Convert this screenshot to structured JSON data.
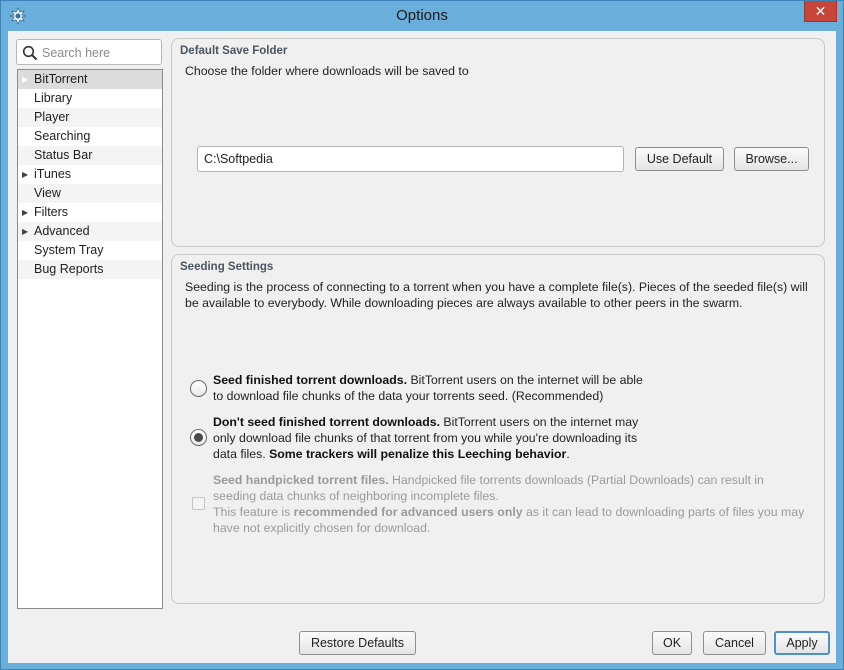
{
  "window": {
    "title": "Options"
  },
  "search": {
    "placeholder": "Search here"
  },
  "sidebar": {
    "items": [
      {
        "label": "BitTorrent",
        "expandable": true
      },
      {
        "label": "Library",
        "expandable": false
      },
      {
        "label": "Player",
        "expandable": false
      },
      {
        "label": "Searching",
        "expandable": false
      },
      {
        "label": "Status Bar",
        "expandable": false
      },
      {
        "label": "iTunes",
        "expandable": true
      },
      {
        "label": "View",
        "expandable": false
      },
      {
        "label": "Filters",
        "expandable": true
      },
      {
        "label": "Advanced",
        "expandable": true
      },
      {
        "label": "System Tray",
        "expandable": false
      },
      {
        "label": "Bug Reports",
        "expandable": false
      }
    ],
    "selected_index": 0
  },
  "save_folder": {
    "title": "Default Save Folder",
    "description": "Choose the folder where downloads will be saved to",
    "path_value": "C:\\Softpedia",
    "use_default_label": "Use Default",
    "browse_label": "Browse..."
  },
  "seeding": {
    "title": "Seeding Settings",
    "description_line1": "Seeding is the process of connecting to a torrent when you have a complete file(s). Pieces of the seeded file(s) will",
    "description_line2": "be available to everybody. While downloading pieces are always available to other peers in the swarm.",
    "options": {
      "seed": {
        "bold": "Seed finished torrent downloads.",
        "text_line1": " BitTorrent users on the internet will be able",
        "text_line2": "to download file chunks of the data your torrents seed. (Recommended)",
        "selected": false
      },
      "dont_seed": {
        "bold": "Don't seed finished torrent downloads.",
        "text_line1": " BitTorrent users on the internet may",
        "text_line2": "only download file chunks of that torrent from you while you're downloading its",
        "text_line3_plain": "data files. ",
        "text_line3_bold": "Some trackers will penalize this Leeching behavior",
        "text_line3_end": ".",
        "selected": true
      },
      "handpicked": {
        "bold": "Seed handpicked torrent files.",
        "text_line1": " Handpicked file torrents downloads (Partial Downloads) can result in",
        "text_line2": "seeding data chunks of neighboring incomplete files.",
        "text_line3_plain": "This feature is ",
        "text_line3_bold": "recommended for advanced users only",
        "text_line3_end": " as it can lead to downloading parts of files you may",
        "text_line4": "have not explicitly chosen for download.",
        "checked": false,
        "enabled": false
      }
    }
  },
  "footer": {
    "restore_label": "Restore Defaults",
    "ok_label": "OK",
    "cancel_label": "Cancel",
    "apply_label": "Apply"
  },
  "colors": {
    "title_bar": "#6aaedb",
    "close_button": "#c7463c",
    "focus_border": "#4f8fd0"
  }
}
